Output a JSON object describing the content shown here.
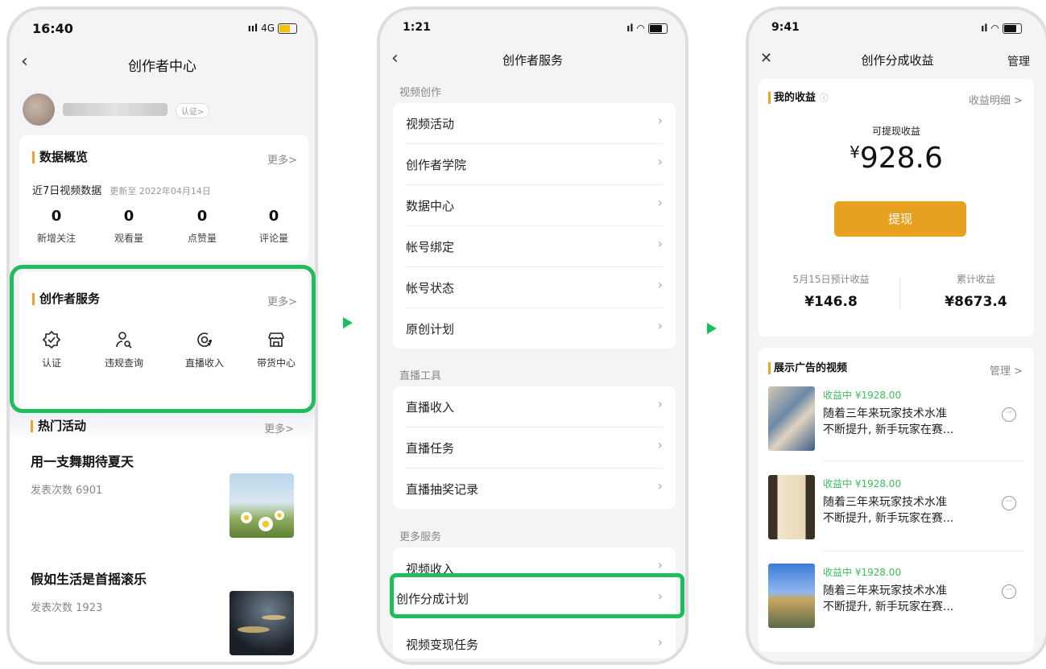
{
  "phone1": {
    "time": "16:40",
    "signal": "4G",
    "title": "创作者中心",
    "verify_badge": "认证>",
    "overview": {
      "title": "数据概览",
      "more": "更多>",
      "subtitle": "近7日视频数据",
      "updated": "更新至 2022年04月14日",
      "stats": [
        {
          "value": "0",
          "label": "新增关注"
        },
        {
          "value": "0",
          "label": "观看量"
        },
        {
          "value": "0",
          "label": "点赞量"
        },
        {
          "value": "0",
          "label": "评论量"
        }
      ]
    },
    "services": {
      "title": "创作者服务",
      "more": "更多>",
      "items": [
        {
          "label": "认证",
          "icon": "verified-badge-icon"
        },
        {
          "label": "违规查询",
          "icon": "user-search-icon"
        },
        {
          "label": "直播收入",
          "icon": "live-income-icon"
        },
        {
          "label": "带货中心",
          "icon": "store-icon"
        }
      ]
    },
    "activities": {
      "title": "热门活动",
      "more": "更多>",
      "items": [
        {
          "title": "用一支舞期待夏天",
          "count_label": "发表次数",
          "count": "6901"
        },
        {
          "title": "假如生活是首摇滚乐",
          "count_label": "发表次数",
          "count": "1923"
        }
      ]
    }
  },
  "phone2": {
    "time": "1:21",
    "title": "创作者服务",
    "sections": [
      {
        "title": "视频创作",
        "items": [
          "视频活动",
          "创作者学院",
          "数据中心",
          "帐号绑定",
          "帐号状态",
          "原创计划"
        ]
      },
      {
        "title": "直播工具",
        "items": [
          "直播收入",
          "直播任务",
          "直播抽奖记录"
        ]
      },
      {
        "title": "更多服务",
        "items": [
          "视频收入",
          "创作分成计划",
          "视频变现任务"
        ]
      }
    ]
  },
  "phone3": {
    "time": "9:41",
    "title": "创作分成收益",
    "manage": "管理",
    "earnings": {
      "title": "我的收益",
      "detail": "收益明细 >",
      "withdrawable_label": "可提现收益",
      "currency": "¥",
      "amount": "928.6",
      "withdraw_button": "提现",
      "est_label": "5月15日预计收益",
      "est_value": "¥146.8",
      "total_label": "累计收益",
      "total_value": "¥8673.4"
    },
    "ads": {
      "title": "展示广告的视频",
      "manage": "管理 >",
      "videos": [
        {
          "status": "收益中 ¥1928.00",
          "line1": "随着三年来玩家技术水准",
          "line2": "不断提升, 新手玩家在赛..."
        },
        {
          "status": "收益中 ¥1928.00",
          "line1": "随着三年来玩家技术水准",
          "line2": "不断提升, 新手玩家在赛..."
        },
        {
          "status": "收益中 ¥1928.00",
          "line1": "随着三年来玩家技术水准",
          "line2": "不断提升, 新手玩家在赛..."
        }
      ]
    }
  },
  "colors": {
    "accent": "#e8a020",
    "highlight": "#1dbe5b",
    "earning_green": "#3bbf5a"
  }
}
